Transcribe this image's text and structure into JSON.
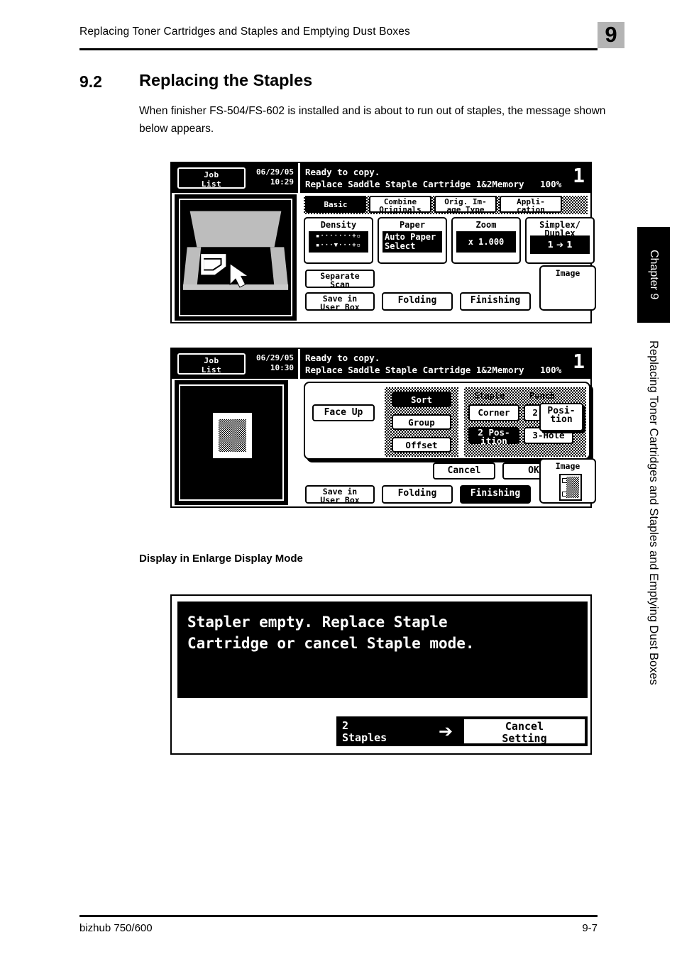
{
  "header": {
    "running_title": "Replacing Toner Cartridges and Staples and Emptying Dust Boxes",
    "chapter_number": "9"
  },
  "section": {
    "number": "9.2",
    "title": "Replacing the Staples",
    "intro": "When finisher FS-504/FS-602 is installed and is about to run out of staples, the message shown below appears."
  },
  "panel1": {
    "job_list_line1": "Job",
    "job_list_line2": "List",
    "date": "06/29/05",
    "time": "10:29",
    "message_line1": "Ready to copy.",
    "message_line2": "Replace Saddle Staple Cartridge 1&2Memory   100%",
    "copies": "1",
    "tabs": [
      {
        "line1": "Basic",
        "line2": "",
        "selected": true
      },
      {
        "line1": "Combine",
        "line2": "Originals",
        "selected": false
      },
      {
        "line1": "Orig. Im-",
        "line2": "age Type",
        "selected": false
      },
      {
        "line1": "Appli-",
        "line2": "cation",
        "selected": false
      }
    ],
    "function_buttons": [
      {
        "title1": "Density",
        "title2": "",
        "value1": "",
        "value2": ""
      },
      {
        "title1": "Paper",
        "title2": "",
        "value1": "Auto Paper",
        "value2": "Select"
      },
      {
        "title1": "Zoom",
        "title2": "",
        "value1": "x 1.000",
        "value2": ""
      },
      {
        "title1": "Simplex/",
        "title2": "Duplex",
        "value1": "1 ➔ 1",
        "value2": ""
      }
    ],
    "separate_scan_line1": "Separate",
    "separate_scan_line2": "Scan",
    "save_box_line1": "Save in",
    "save_box_line2": "User Box",
    "folding_label": "Folding",
    "finishing_label": "Finishing",
    "image_label": "Image"
  },
  "panel2": {
    "job_list_line1": "Job",
    "job_list_line2": "List",
    "date": "06/29/05",
    "time": "10:30",
    "message_line1": "Ready to copy.",
    "message_line2": "Replace Saddle Staple Cartridge 1&2Memory   100%",
    "copies": "1",
    "face_up_label": "Face Up",
    "sort_options": [
      {
        "label": "Sort",
        "selected": true
      },
      {
        "label": "Group",
        "selected": false
      },
      {
        "label": "Offset",
        "selected": false
      }
    ],
    "staple_group_label": "Staple",
    "punch_group_label": "Punch",
    "staple_options": [
      {
        "line1": "Corner",
        "line2": "",
        "selected": false
      },
      {
        "line1": "2 Pos-",
        "line2": "ition",
        "selected": true
      }
    ],
    "punch_options": [
      {
        "line1": "2-Hole",
        "line2": "",
        "selected": false
      },
      {
        "line1": "3-Hole",
        "line2": "",
        "selected": false
      }
    ],
    "position_line1": "Posi-",
    "position_line2": "tion",
    "cancel_label": "Cancel",
    "ok_label": "OK",
    "save_box_line1": "Save in",
    "save_box_line2": "User Box",
    "folding_label": "Folding",
    "finishing_label": "Finishing",
    "image_label": "Image"
  },
  "enlarge": {
    "caption": "Display in Enlarge Display Mode",
    "message_line1": "Stapler empty. Replace Staple",
    "message_line2": "Cartridge or cancel Staple mode.",
    "left_button_line1": "2",
    "left_button_line2": "Staples",
    "arrow": "➔",
    "right_button_line1": "Cancel",
    "right_button_line2": "Setting"
  },
  "side": {
    "chapter_tab": "Chapter 9",
    "vertical_title": "Replacing Toner Cartridges and Staples and Emptying Dust Boxes"
  },
  "footer": {
    "left": "bizhub 750/600",
    "right": "9-7"
  }
}
